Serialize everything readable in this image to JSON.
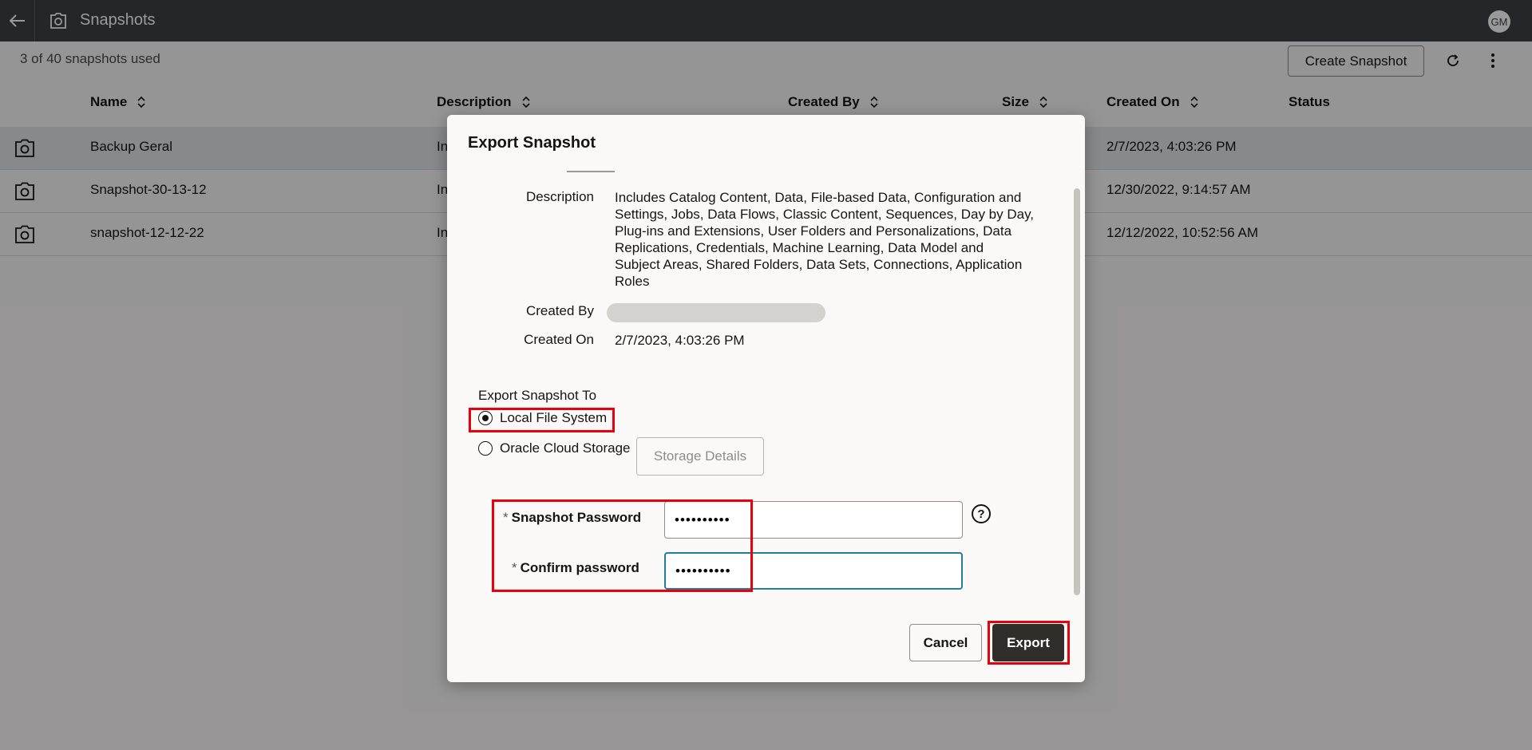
{
  "topbar": {
    "title": "Snapshots",
    "avatar_initials": "GM",
    "back_icon": "back-arrow-icon",
    "app_icon": "camera-icon"
  },
  "toolbar": {
    "quota_text": "3 of 40 snapshots used",
    "create_label": "Create Snapshot",
    "refresh_icon": "refresh-icon",
    "more_icon": "more-vertical-icon"
  },
  "table": {
    "columns": [
      "Name",
      "Description",
      "Created By",
      "Size",
      "Created On",
      "Status"
    ],
    "rows": [
      {
        "name": "Backup Geral",
        "description": "In",
        "created_on": "2/7/2023, 4:03:26 PM",
        "selected": true
      },
      {
        "name": "Snapshot-30-13-12",
        "description": "In",
        "created_on": "12/30/2022, 9:14:57 AM",
        "selected": false
      },
      {
        "name": "snapshot-12-12-22",
        "description": "In",
        "created_on": "12/12/2022, 10:52:56 AM",
        "selected": false
      }
    ]
  },
  "dialog": {
    "title": "Export Snapshot",
    "description_label": "Description",
    "description_value": "Includes Catalog Content, Data, File-based Data, Configuration and Settings, Jobs, Data Flows, Classic Content, Sequences, Day by Day, Plug-ins and Extensions, User Folders and Personalizations, Data Replications, Credentials, Machine Learning, Data Model and Subject Areas, Shared Folders, Data Sets, Connections, Application Roles",
    "description_lines": [
      "Includes Catalog Content, Data, File-based Data, Configuration and",
      "Settings, Jobs, Data Flows, Classic Content, Sequences, Day by Day,",
      "Plug-ins and Extensions, User Folders and Personalizations, Data",
      "Replications, Credentials, Machine Learning, Data Model and",
      "Subject Areas, Shared Folders, Data Sets, Connections, Application",
      "Roles"
    ],
    "created_by_label": "Created By",
    "created_on_label": "Created On",
    "created_on_value": "2/7/2023, 4:03:26 PM",
    "export_to_label": "Export Snapshot To",
    "option_local": "Local File System",
    "option_cloud": "Oracle Cloud Storage",
    "selected_option": "Local File System",
    "storage_details_label": "Storage Details",
    "required_marker": "*",
    "password_label": "Snapshot Password",
    "password_value": "••••••••••",
    "confirm_label": "Confirm password",
    "confirm_value": "••••••••••",
    "help_glyph": "?",
    "cancel_label": "Cancel",
    "export_label": "Export"
  },
  "colors": {
    "topbar_bg": "#3e4046",
    "selected_row": "#dfe6ea",
    "primary_button": "#312d2a",
    "focus_border": "#227e9e",
    "highlight": "#e8000b"
  }
}
